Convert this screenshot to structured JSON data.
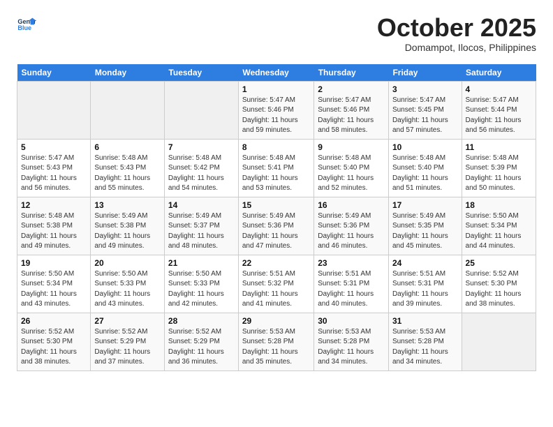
{
  "header": {
    "logo_line1": "General",
    "logo_line2": "Blue",
    "month": "October 2025",
    "location": "Domampot, Ilocos, Philippines"
  },
  "days_of_week": [
    "Sunday",
    "Monday",
    "Tuesday",
    "Wednesday",
    "Thursday",
    "Friday",
    "Saturday"
  ],
  "weeks": [
    [
      {
        "num": "",
        "info": ""
      },
      {
        "num": "",
        "info": ""
      },
      {
        "num": "",
        "info": ""
      },
      {
        "num": "1",
        "info": "Sunrise: 5:47 AM\nSunset: 5:46 PM\nDaylight: 11 hours\nand 59 minutes."
      },
      {
        "num": "2",
        "info": "Sunrise: 5:47 AM\nSunset: 5:46 PM\nDaylight: 11 hours\nand 58 minutes."
      },
      {
        "num": "3",
        "info": "Sunrise: 5:47 AM\nSunset: 5:45 PM\nDaylight: 11 hours\nand 57 minutes."
      },
      {
        "num": "4",
        "info": "Sunrise: 5:47 AM\nSunset: 5:44 PM\nDaylight: 11 hours\nand 56 minutes."
      }
    ],
    [
      {
        "num": "5",
        "info": "Sunrise: 5:47 AM\nSunset: 5:43 PM\nDaylight: 11 hours\nand 56 minutes."
      },
      {
        "num": "6",
        "info": "Sunrise: 5:48 AM\nSunset: 5:43 PM\nDaylight: 11 hours\nand 55 minutes."
      },
      {
        "num": "7",
        "info": "Sunrise: 5:48 AM\nSunset: 5:42 PM\nDaylight: 11 hours\nand 54 minutes."
      },
      {
        "num": "8",
        "info": "Sunrise: 5:48 AM\nSunset: 5:41 PM\nDaylight: 11 hours\nand 53 minutes."
      },
      {
        "num": "9",
        "info": "Sunrise: 5:48 AM\nSunset: 5:40 PM\nDaylight: 11 hours\nand 52 minutes."
      },
      {
        "num": "10",
        "info": "Sunrise: 5:48 AM\nSunset: 5:40 PM\nDaylight: 11 hours\nand 51 minutes."
      },
      {
        "num": "11",
        "info": "Sunrise: 5:48 AM\nSunset: 5:39 PM\nDaylight: 11 hours\nand 50 minutes."
      }
    ],
    [
      {
        "num": "12",
        "info": "Sunrise: 5:48 AM\nSunset: 5:38 PM\nDaylight: 11 hours\nand 49 minutes."
      },
      {
        "num": "13",
        "info": "Sunrise: 5:49 AM\nSunset: 5:38 PM\nDaylight: 11 hours\nand 49 minutes."
      },
      {
        "num": "14",
        "info": "Sunrise: 5:49 AM\nSunset: 5:37 PM\nDaylight: 11 hours\nand 48 minutes."
      },
      {
        "num": "15",
        "info": "Sunrise: 5:49 AM\nSunset: 5:36 PM\nDaylight: 11 hours\nand 47 minutes."
      },
      {
        "num": "16",
        "info": "Sunrise: 5:49 AM\nSunset: 5:36 PM\nDaylight: 11 hours\nand 46 minutes."
      },
      {
        "num": "17",
        "info": "Sunrise: 5:49 AM\nSunset: 5:35 PM\nDaylight: 11 hours\nand 45 minutes."
      },
      {
        "num": "18",
        "info": "Sunrise: 5:50 AM\nSunset: 5:34 PM\nDaylight: 11 hours\nand 44 minutes."
      }
    ],
    [
      {
        "num": "19",
        "info": "Sunrise: 5:50 AM\nSunset: 5:34 PM\nDaylight: 11 hours\nand 43 minutes."
      },
      {
        "num": "20",
        "info": "Sunrise: 5:50 AM\nSunset: 5:33 PM\nDaylight: 11 hours\nand 43 minutes."
      },
      {
        "num": "21",
        "info": "Sunrise: 5:50 AM\nSunset: 5:33 PM\nDaylight: 11 hours\nand 42 minutes."
      },
      {
        "num": "22",
        "info": "Sunrise: 5:51 AM\nSunset: 5:32 PM\nDaylight: 11 hours\nand 41 minutes."
      },
      {
        "num": "23",
        "info": "Sunrise: 5:51 AM\nSunset: 5:31 PM\nDaylight: 11 hours\nand 40 minutes."
      },
      {
        "num": "24",
        "info": "Sunrise: 5:51 AM\nSunset: 5:31 PM\nDaylight: 11 hours\nand 39 minutes."
      },
      {
        "num": "25",
        "info": "Sunrise: 5:52 AM\nSunset: 5:30 PM\nDaylight: 11 hours\nand 38 minutes."
      }
    ],
    [
      {
        "num": "26",
        "info": "Sunrise: 5:52 AM\nSunset: 5:30 PM\nDaylight: 11 hours\nand 38 minutes."
      },
      {
        "num": "27",
        "info": "Sunrise: 5:52 AM\nSunset: 5:29 PM\nDaylight: 11 hours\nand 37 minutes."
      },
      {
        "num": "28",
        "info": "Sunrise: 5:52 AM\nSunset: 5:29 PM\nDaylight: 11 hours\nand 36 minutes."
      },
      {
        "num": "29",
        "info": "Sunrise: 5:53 AM\nSunset: 5:28 PM\nDaylight: 11 hours\nand 35 minutes."
      },
      {
        "num": "30",
        "info": "Sunrise: 5:53 AM\nSunset: 5:28 PM\nDaylight: 11 hours\nand 34 minutes."
      },
      {
        "num": "31",
        "info": "Sunrise: 5:53 AM\nSunset: 5:28 PM\nDaylight: 11 hours\nand 34 minutes."
      },
      {
        "num": "",
        "info": ""
      }
    ]
  ]
}
